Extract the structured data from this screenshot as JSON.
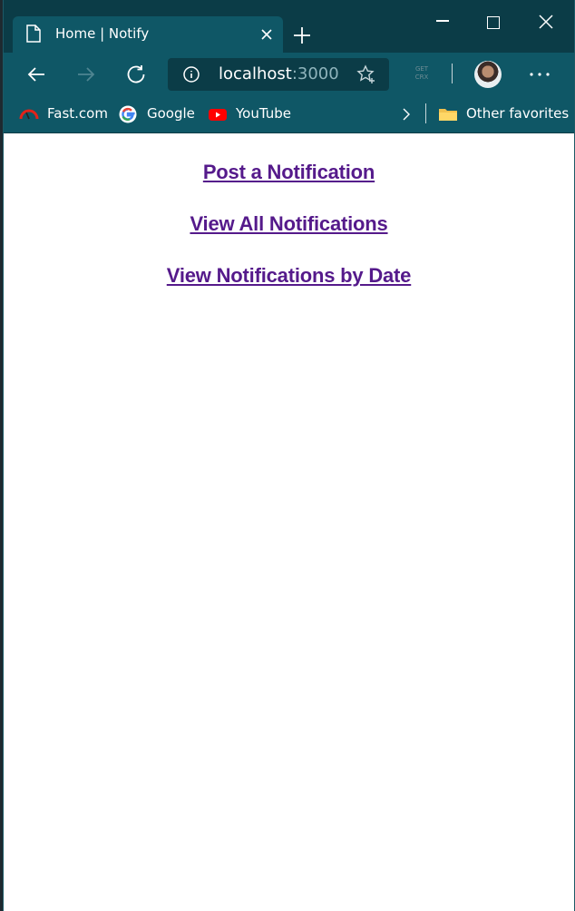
{
  "browser": {
    "tab": {
      "title": "Home | Notify"
    },
    "address": {
      "host": "localhost",
      "port": ":3000"
    },
    "extension_label": "GET\nCRX",
    "favorites": [
      {
        "label": "Fast.com",
        "icon": "gauge-icon"
      },
      {
        "label": "Google",
        "icon": "google-icon"
      },
      {
        "label": "YouTube",
        "icon": "youtube-icon"
      }
    ],
    "other_favorites": "Other favorites"
  },
  "page": {
    "links": [
      {
        "label": "Post a Notification"
      },
      {
        "label": "View All Notifications"
      },
      {
        "label": "View Notifications by Date"
      }
    ],
    "link_color": "#551a8b"
  },
  "colors": {
    "titlebar": "#0b3c47",
    "toolbar": "#0f5766"
  }
}
